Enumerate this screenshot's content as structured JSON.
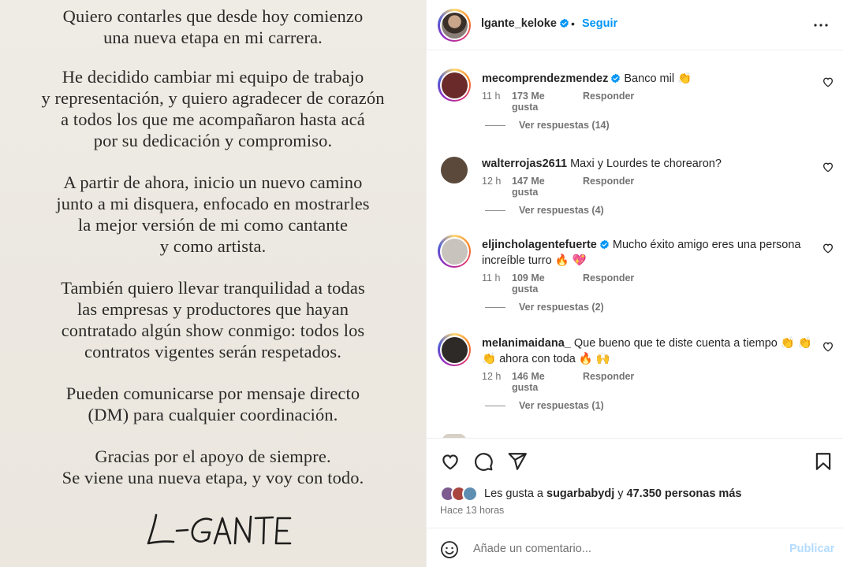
{
  "post_image": {
    "paragraphs": [
      [
        "Quiero contarles que desde hoy comienzo",
        "una nueva etapa en mi carrera."
      ],
      [
        "He decidido cambiar mi equipo de trabajo",
        "y representación, y quiero agradecer de corazón",
        "a todos los que me acompañaron hasta acá",
        "por su dedicación y compromiso."
      ],
      [
        "A partir de ahora, inicio un nuevo camino",
        "junto a mi disquera, enfocado en mostrarles",
        "la mejor versión de mi como cantante",
        "y como artista."
      ],
      [
        "También quiero llevar tranquilidad a todas",
        "las empresas y productores que hayan",
        "contratado algún show conmigo: todos los",
        "contratos vigentes serán respetados."
      ],
      [
        "Pueden comunicarse por mensaje directo",
        "(DM) para cualquier coordinación."
      ],
      [
        "Gracias por el apoyo de siempre.",
        "Se viene una nueva etapa, y voy con todo."
      ]
    ],
    "signature": "L-GANTE"
  },
  "header": {
    "username": "lgante_keloke",
    "verified": true,
    "separator": "•",
    "follow_label": "Seguir",
    "more_icon": "more-horizontal-icon"
  },
  "comments": [
    {
      "username": "mecomprendezmendez",
      "verified": true,
      "text": "Banco mil 👏",
      "time": "11 h",
      "likes": "173 Me gusta",
      "reply_label": "Responder",
      "view_replies": "Ver respuestas (14)",
      "story_ring": true,
      "avatar_color": "#6a2a2a"
    },
    {
      "username": "walterrojas2611",
      "verified": false,
      "text": "Maxi y Lourdes te chorearon?",
      "time": "12 h",
      "likes": "147 Me gusta",
      "reply_label": "Responder",
      "view_replies": "Ver respuestas (4)",
      "story_ring": false,
      "avatar_color": "#5b4a3c"
    },
    {
      "username": "eljincholagentefuerte",
      "verified": true,
      "text": "Mucho éxito amigo eres una persona increíble turro 🔥 💖",
      "time": "11 h",
      "likes": "109 Me gusta",
      "reply_label": "Responder",
      "view_replies": "Ver respuestas (2)",
      "story_ring": true,
      "avatar_color": "#c9c3bd"
    },
    {
      "username": "melanimaidana_",
      "verified": false,
      "text": "Que bueno que te diste cuenta a tiempo 👏 👏 👏 ahora con toda 🔥 🙌",
      "time": "12 h",
      "likes": "146 Me gusta",
      "reply_label": "Responder",
      "view_replies": "Ver respuestas (1)",
      "story_ring": true,
      "avatar_color": "#2e2a28"
    }
  ],
  "actions": {
    "like_icon": "heart-icon",
    "comment_icon": "comment-icon",
    "share_icon": "share-icon",
    "save_icon": "bookmark-icon",
    "likes_prefix": "Les gusta a",
    "likes_user": "sugarbabydj",
    "likes_connector": "y",
    "likes_others": "47.350 personas más",
    "time_ago": "Hace 13 horas"
  },
  "comment_box": {
    "emoji_icon": "smiley-icon",
    "placeholder": "Añade un comentario...",
    "publish_label": "Publicar"
  },
  "colors": {
    "accent": "#0095f6",
    "publish_disabled": "#b3dbff",
    "muted_text": "#737373",
    "image_background": "#ece8e1"
  }
}
